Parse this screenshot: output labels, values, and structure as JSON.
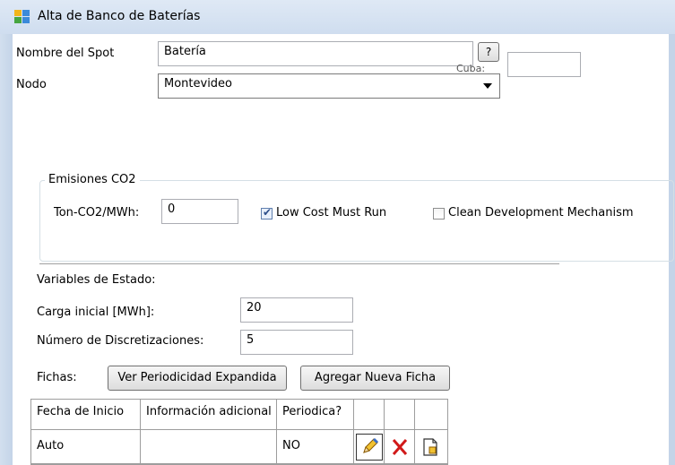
{
  "window": {
    "title": "Alta de Banco de Baterías"
  },
  "form": {
    "nombre_label": "Nombre del Spot",
    "nombre_value": "Batería",
    "help_label": "?",
    "hidden_label": "Cuba:",
    "nodo_label": "Nodo",
    "nodo_value": "Montevideo"
  },
  "emisiones": {
    "group_label": "Emisiones CO2",
    "ton_label": "Ton-CO2/MWh:",
    "ton_value": "0",
    "low_cost_label": "Low Cost Must Run",
    "low_cost_checked": true,
    "clean_dev_label": "Clean Development Mechanism",
    "clean_dev_checked": false
  },
  "estado": {
    "heading": "Variables de Estado:",
    "carga_label": "Carga inicial [MWh]:",
    "carga_value": "20",
    "discret_label": "Número de Discretizaciones:",
    "discret_value": "5"
  },
  "fichas": {
    "label": "Fichas:",
    "ver_button": "Ver Periodicidad Expandida",
    "agregar_button": "Agregar Nueva Ficha",
    "columns": [
      "Fecha de Inicio",
      "Información adicional",
      "Periodica?"
    ],
    "rows": [
      {
        "fecha": "Auto",
        "info": "",
        "periodica": "NO"
      }
    ],
    "row_icons": [
      "pencil-icon",
      "delete-x-icon",
      "clone-icon"
    ]
  },
  "colors": {
    "accent": "#2d4f8a",
    "delete": "#d11a1a",
    "title_bar": "#dfe9f5"
  }
}
